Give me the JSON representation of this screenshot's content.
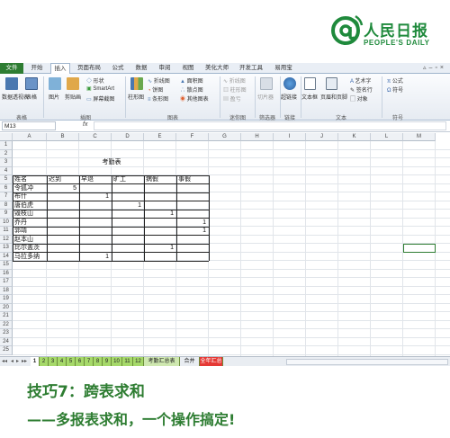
{
  "logo": {
    "name_cn": "人民日报",
    "name_en": "PEOPLE'S DAILY"
  },
  "ribbon_tabs": [
    {
      "label": "文件"
    },
    {
      "label": "开始"
    },
    {
      "label": "插入"
    },
    {
      "label": "页面布局"
    },
    {
      "label": "公式"
    },
    {
      "label": "数据"
    },
    {
      "label": "审阅"
    },
    {
      "label": "视图"
    },
    {
      "label": "美化大师"
    },
    {
      "label": "开发工具"
    },
    {
      "label": "易用宝"
    }
  ],
  "active_tab": "插入",
  "ribbon": {
    "pivot": "数据透视表",
    "table": "表格",
    "picture": "图片",
    "clipart": "剪贴画",
    "shapes": "形状",
    "smartart": "SmartArt",
    "screenshot": "屏幕截图",
    "column": "柱形图",
    "line": "折线图",
    "pie": "饼图",
    "bar": "条形图",
    "area": "面积图",
    "scatter": "散点图",
    "other": "其他图表",
    "spark_line": "折线图",
    "spark_col": "柱形图",
    "spark_wl": "盈亏",
    "slicer": "切片器",
    "hyperlink": "超链接",
    "textbox": "文本框",
    "header": "页眉和页脚",
    "wordart": "艺术字",
    "signature": "签名行",
    "object": "对象",
    "equation": "公式",
    "symbol": "符号",
    "groups": {
      "tables": "表格",
      "illustrations": "插图",
      "charts": "图表",
      "sparklines": "迷你图",
      "filter": "筛选器",
      "links": "链接",
      "text": "文本",
      "symbols": "符号"
    }
  },
  "formula_bar": {
    "name_box": "M13",
    "fx": "fx",
    "value": ""
  },
  "columns": [
    "A",
    "B",
    "C",
    "D",
    "E",
    "F",
    "G",
    "H",
    "I",
    "J",
    "K",
    "L",
    "M"
  ],
  "rows": [
    "1",
    "2",
    "3",
    "4",
    "5",
    "6",
    "7",
    "8",
    "9",
    "10",
    "11",
    "12",
    "13",
    "14",
    "15",
    "16",
    "17",
    "18",
    "19",
    "20",
    "21",
    "22",
    "23",
    "24",
    "25"
  ],
  "sheet": {
    "title": "考勤表",
    "headers": [
      "姓名",
      "迟到",
      "早退",
      "旷工",
      "病假",
      "事假"
    ],
    "records": [
      {
        "name": "令狐冲",
        "cols": [
          "5",
          "",
          "",
          "",
          ""
        ]
      },
      {
        "name": "布什",
        "cols": [
          "",
          "1",
          "",
          "",
          ""
        ]
      },
      {
        "name": "唐伯虎",
        "cols": [
          "",
          "",
          "1",
          "",
          ""
        ]
      },
      {
        "name": "毁枝山",
        "cols": [
          "",
          "",
          "",
          "1",
          ""
        ]
      },
      {
        "name": "乔丹",
        "cols": [
          "",
          "",
          "",
          "",
          "1"
        ]
      },
      {
        "name": "郭靖",
        "cols": [
          "",
          "",
          "",
          "",
          "1"
        ]
      },
      {
        "name": "赵本山",
        "cols": [
          "",
          "",
          "",
          "",
          ""
        ]
      },
      {
        "name": "比尔盖茨",
        "cols": [
          "",
          "",
          "",
          "1",
          ""
        ]
      },
      {
        "name": "马拉多纳",
        "cols": [
          "",
          "1",
          "",
          "",
          ""
        ]
      }
    ]
  },
  "sheet_tabs": [
    {
      "label": "1"
    },
    {
      "label": "2"
    },
    {
      "label": "3"
    },
    {
      "label": "4"
    },
    {
      "label": "5"
    },
    {
      "label": "6"
    },
    {
      "label": "7"
    },
    {
      "label": "8"
    },
    {
      "label": "9"
    },
    {
      "label": "10"
    },
    {
      "label": "11"
    },
    {
      "label": "12"
    },
    {
      "label": "考勤汇总表"
    },
    {
      "label": "合并"
    },
    {
      "label": "全年汇总"
    }
  ],
  "caption": {
    "line1": "技巧7：跨表求和",
    "line2": "——多报表求和，一个操作搞定!"
  },
  "colors": {
    "brand_green": "#2e7d32",
    "file_tab": "#2e7d32",
    "sheet_tab_green": "#a6d96a",
    "sheet_tab_red": "#e53935"
  }
}
